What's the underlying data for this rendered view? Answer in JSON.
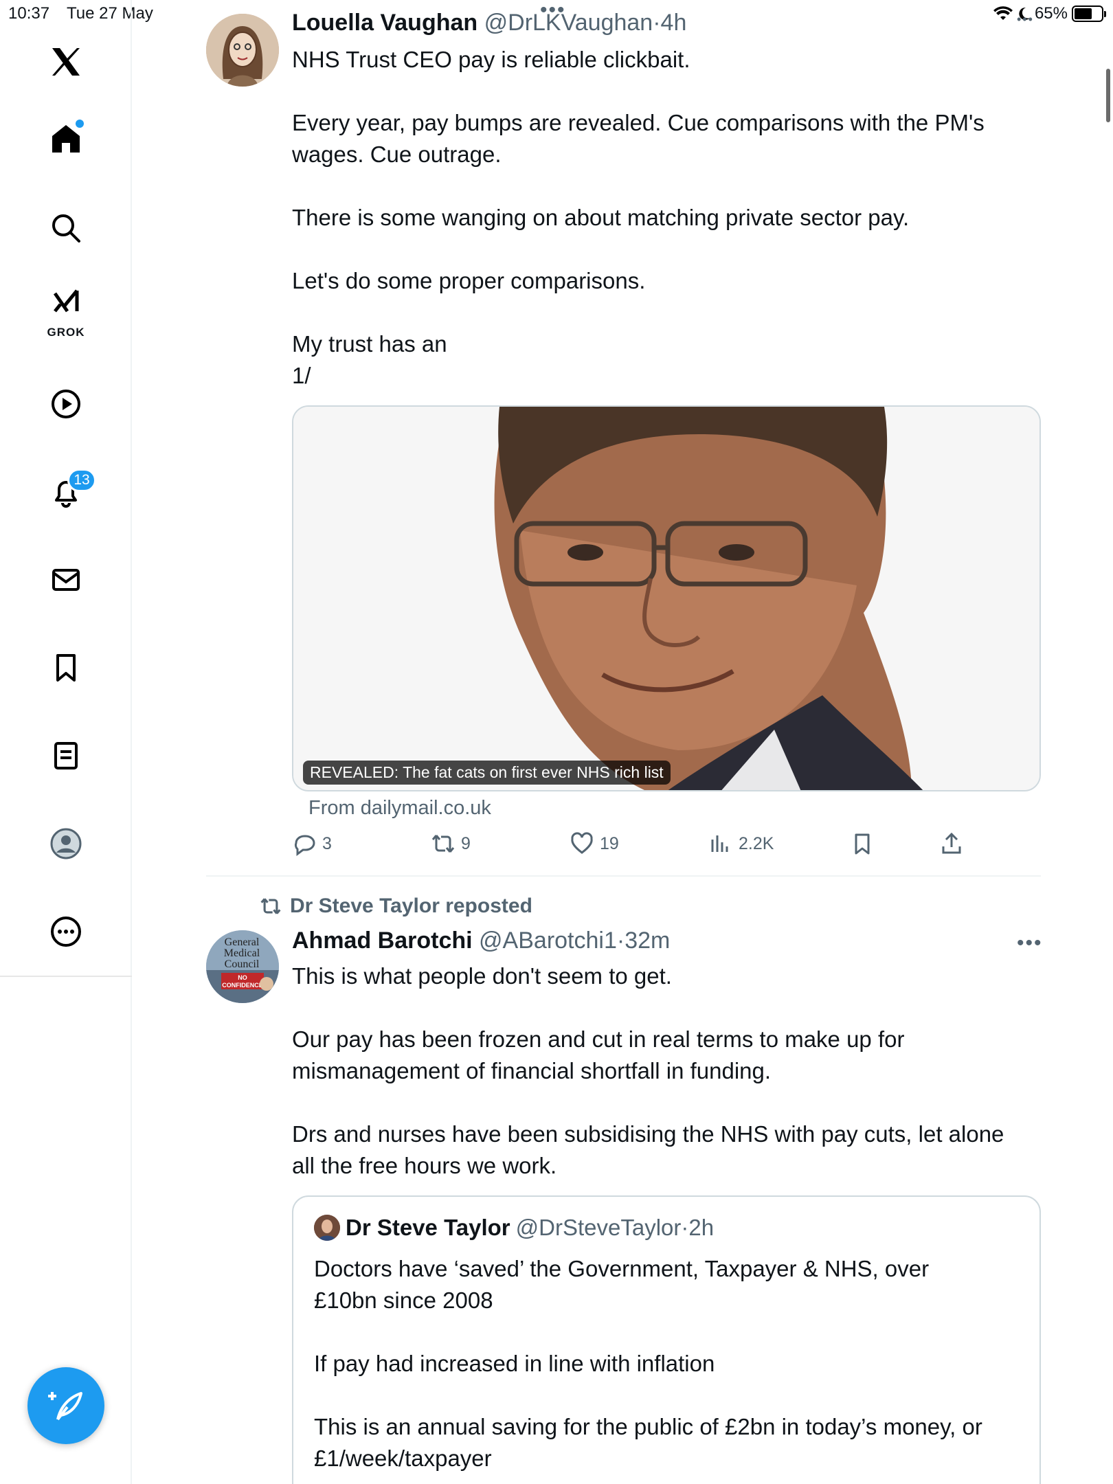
{
  "status_bar": {
    "time": "10:37",
    "date": "Tue 27 May",
    "battery": "65%",
    "battery_level": 0.65
  },
  "sidebar": {
    "logo": "x-logo-icon",
    "items": [
      {
        "name": "home",
        "icon": "home-icon",
        "has_dot": true
      },
      {
        "name": "explore",
        "icon": "search-icon"
      },
      {
        "name": "grok",
        "icon": "grok-icon",
        "label": "GROK"
      },
      {
        "name": "videos",
        "icon": "play-icon"
      },
      {
        "name": "notifications",
        "icon": "bell-icon",
        "badge": "13"
      },
      {
        "name": "messages",
        "icon": "mail-icon"
      },
      {
        "name": "bookmarks",
        "icon": "bookmark-icon"
      },
      {
        "name": "lists",
        "icon": "list-icon"
      },
      {
        "name": "profile",
        "icon": "avatar-icon"
      },
      {
        "name": "more",
        "icon": "more-icon"
      }
    ],
    "compose_icon": "compose-icon"
  },
  "posts": [
    {
      "author_name": "Louella Vaughan",
      "author_handle": "@DrLKVaughan",
      "time": "4h",
      "text": "NHS Trust CEO pay is reliable clickbait.\n\nEvery year, pay bumps are revealed. Cue comparisons with the PM's\nwages. Cue outrage.\n\nThere is some wanging on about matching private sector pay.\n\nLet's do some proper comparisons.\n\nMy trust has an\n1/",
      "link_card": {
        "caption": "REVEALED: The fat cats on first ever NHS rich list",
        "source": "From dailymail.co.uk"
      },
      "stats": {
        "replies": "3",
        "reposts": "9",
        "likes": "19",
        "views": "2.2K"
      }
    },
    {
      "repost_by": "Dr Steve Taylor reposted",
      "author_name": "Ahmad Barotchi",
      "author_handle": "@ABarotchi1",
      "time": "32m",
      "text": "This is what people don't seem to get.\n\nOur pay has been frozen and cut in real terms to make up for\nmismanagement of financial shortfall in funding.\n\nDrs and nurses have been subsidising the NHS with pay cuts, let alone\nall the free hours we work.",
      "avatar_text": [
        "General",
        "Medical",
        "Council",
        "NO",
        "CONFIDENCE"
      ],
      "quote": {
        "author_name": "Dr Steve Taylor",
        "author_handle": "@DrSteveTaylor",
        "time": "2h",
        "text": "Doctors have ‘saved’ the Government, Taxpayer & NHS, over\n£10bn since 2008\n\nIf pay had increased in line with inflation\n\nThis is an annual saving for the public of £2bn in today’s money, or\n£1/week/taxpayer"
      }
    }
  ],
  "separator": "·"
}
